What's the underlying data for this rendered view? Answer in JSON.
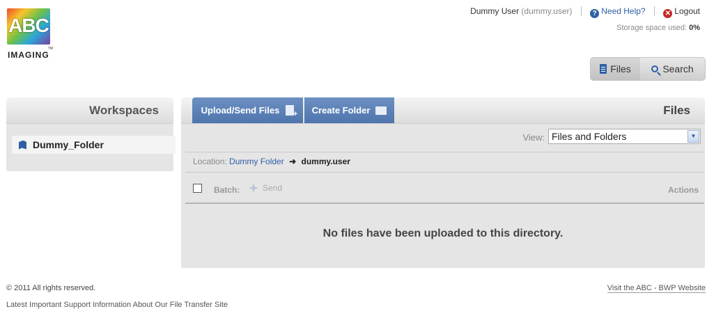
{
  "logo": {
    "text": "ABC",
    "tm": "TM",
    "subtitle": "IMAGING"
  },
  "header": {
    "user_name": "Dummy User",
    "user_id": "(dummy.user)",
    "help_label": "Need Help?",
    "logout_label": "Logout",
    "storage_label": "Storage space used:",
    "storage_value": "0%"
  },
  "view_toggle": {
    "files_label": "Files",
    "search_label": "Search"
  },
  "workspaces": {
    "title": "Workspaces",
    "items": [
      {
        "label": "Dummy_Folder"
      }
    ]
  },
  "files_panel": {
    "upload_label": "Upload/Send Files",
    "create_folder_label": "Create Folder",
    "title": "Files",
    "view_label": "View:",
    "view_selected": "Files and Folders",
    "location_label": "Location:",
    "location_parent": "Dummy Folder",
    "location_current": "dummy.user",
    "batch_label": "Batch:",
    "send_label": "Send",
    "actions_label": "Actions",
    "empty_message": "No files have been uploaded to this directory."
  },
  "footer": {
    "copyright": "© 2011 All rights reserved.",
    "support_link": "Latest Important Support Information About Our File Transfer Site",
    "website_link": "Visit the ABC - BWP Website"
  },
  "colors": {
    "accent": "#2d5fa3",
    "button_blue": "#5a7fb6",
    "logout_red": "#c62828"
  },
  "icons": [
    "help-icon",
    "logout-icon",
    "files-doc-icon",
    "search-icon",
    "folder-icon",
    "upload-icon",
    "create-folder-icon",
    "send-icon",
    "arrow-right-icon",
    "chevron-down-icon"
  ]
}
